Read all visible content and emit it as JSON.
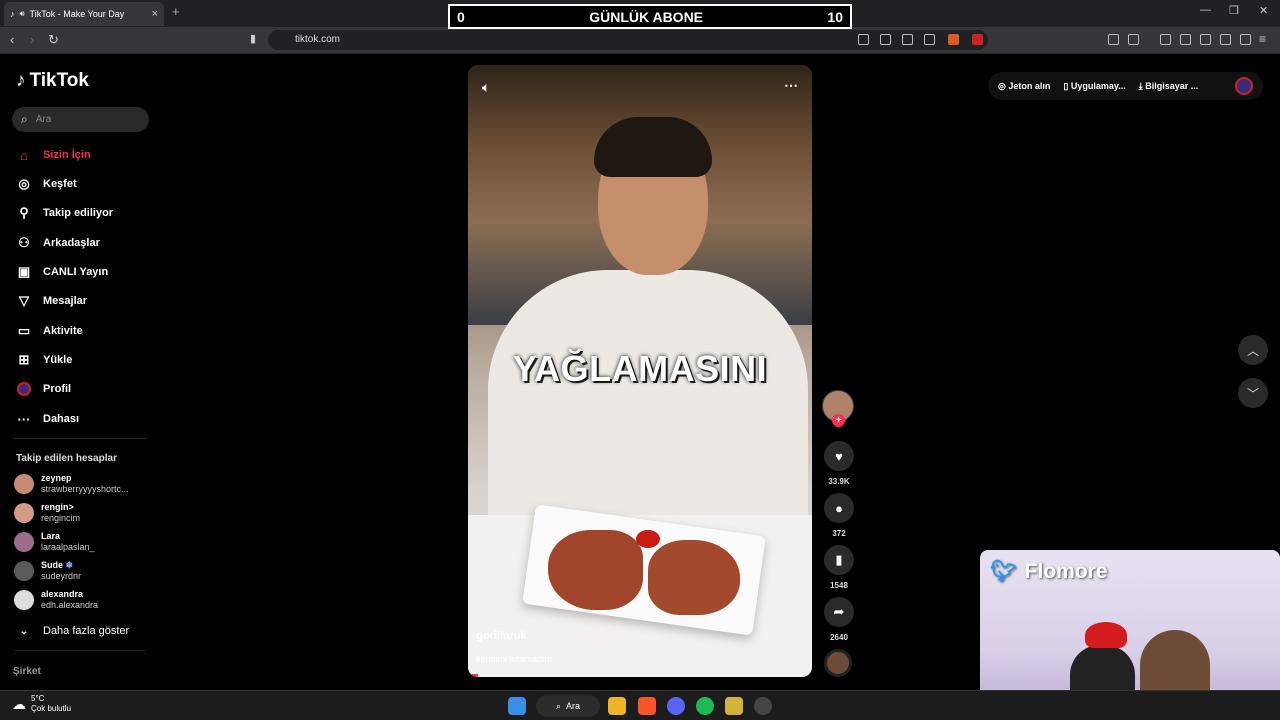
{
  "browser": {
    "tab_title": "TikTok - Make Your Day",
    "url": "tiktok.com"
  },
  "overlay": {
    "left_number": "0",
    "title": "GÜNLÜK ABONE",
    "right_number": "10"
  },
  "sidebar": {
    "logo": "TikTok",
    "search_placeholder": "Ara",
    "nav": [
      {
        "label": "Sizin İçin",
        "icon": "home-icon",
        "active": true
      },
      {
        "label": "Keşfet",
        "icon": "compass-icon"
      },
      {
        "label": "Takip ediliyor",
        "icon": "following-icon"
      },
      {
        "label": "Arkadaşlar",
        "icon": "friends-icon"
      },
      {
        "label": "CANLI Yayın",
        "icon": "live-icon"
      },
      {
        "label": "Mesajlar",
        "icon": "messages-icon"
      },
      {
        "label": "Aktivite",
        "icon": "activity-icon"
      },
      {
        "label": "Yükle",
        "icon": "upload-icon"
      },
      {
        "label": "Profil",
        "icon": "profile-icon"
      },
      {
        "label": "Dahası",
        "icon": "more-icon"
      }
    ],
    "following_title": "Takip edilen hesaplar",
    "following": [
      {
        "name": "zeynep",
        "handle": "strawberryyyyshortc...",
        "color": "#c98a74"
      },
      {
        "name": "rengin>",
        "handle": "rengincim",
        "color": "#d39b86"
      },
      {
        "name": "Lara",
        "handle": "laraalpaslan_",
        "color": "#9a6d8e"
      },
      {
        "name": "Sude",
        "badge": "❄",
        "handle": "sudeyrdnr",
        "color": "#5a5a5a"
      },
      {
        "name": "alexandra",
        "handle": "edh.alexandra",
        "color": "#dedede"
      }
    ],
    "show_more": "Daha fazla göster",
    "company": "Şirket"
  },
  "video": {
    "caption": "YAĞLAMASINI",
    "author": "gorilfaruk",
    "description": "kendimi tutamadım",
    "progress": 0.03
  },
  "actions": {
    "likes": "33.9K",
    "comments": "372",
    "saves": "1548",
    "shares": "2640"
  },
  "top_links": {
    "coins": "Jeton alın",
    "app": "Uygulamay...",
    "desktop": "Bilgisayar ..."
  },
  "stream": {
    "twitter_name": "Flomore"
  },
  "taskbar": {
    "temperature": "5°C",
    "weather_text": "Çok bulutlu",
    "search_label": "Ara"
  },
  "colors": {
    "accent": "#fe2c55",
    "background": "#000000"
  }
}
